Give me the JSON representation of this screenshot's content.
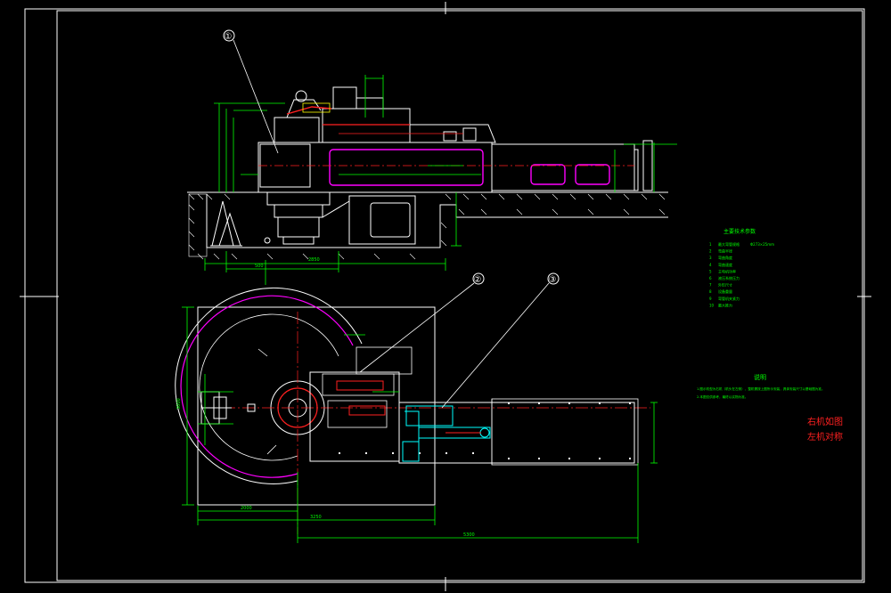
{
  "drawing": {
    "balloons": [
      "①",
      "②",
      "③"
    ],
    "params_title": "主要技术参数",
    "params": [
      {
        "no": "1",
        "name": "最大弯管规格",
        "value": "Φ273×25mm"
      },
      {
        "no": "2",
        "name": "弯曲半径",
        "value": ""
      },
      {
        "no": "3",
        "name": "弯曲角度",
        "value": ""
      },
      {
        "no": "4",
        "name": "弯曲速度",
        "value": ""
      },
      {
        "no": "5",
        "name": "主电机功率",
        "value": ""
      },
      {
        "no": "6",
        "name": "液压系统压力",
        "value": ""
      },
      {
        "no": "7",
        "name": "外形尺寸",
        "value": ""
      },
      {
        "no": "8",
        "name": "设备重量",
        "value": ""
      },
      {
        "no": "9",
        "name": "弯管机夹紧力",
        "value": ""
      },
      {
        "no": "10",
        "name": "最大推力",
        "value": ""
      }
    ],
    "notes_title": "说明",
    "notes": [
      "1.图示机型为右机（机头在左侧），整机需按上图所示安装，具体安装尺寸以基础图为准。",
      "2.本图仅供参考，最终以实物为准。"
    ],
    "side_note_1": "右机如图",
    "side_note_2": "左机对称",
    "dims": {
      "top_total": "2850",
      "top_base": "500",
      "plan_height": "3000",
      "plan_inner": "2000",
      "plan_total": "3250",
      "plan_long": "5300"
    },
    "colors": {
      "line": "#ffffff",
      "dim": "#00ff00",
      "highlight": "#ff00ff",
      "red": "#ff2020",
      "cyan": "#00ffff",
      "yellow": "#ffff00"
    }
  }
}
